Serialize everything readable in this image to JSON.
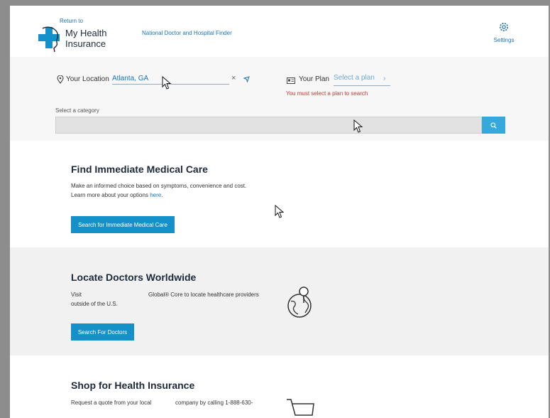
{
  "header": {
    "return_to": "Return to",
    "logo_line1": "My Health",
    "logo_line2": "Insurance",
    "finder_link": "National Doctor and Hospital Finder",
    "settings_label": "Settings"
  },
  "search": {
    "location_label": "Your Location",
    "location_value": "Atlanta, GA",
    "clear_symbol": "×",
    "plan_label": "Your Plan",
    "plan_select": "Select a plan",
    "plan_chevron": "›",
    "plan_error": "You must select a plan to search",
    "category_label": "Select a category"
  },
  "sections": {
    "immediate": {
      "title": "Find Immediate Medical Care",
      "text1": "Make an informed choice based on symptoms, convenience and cost.",
      "text2_prefix": "Learn more about your options ",
      "text2_link": "here",
      "text2_suffix": ".",
      "button": "Search for Immediate Medical Care"
    },
    "worldwide": {
      "title": "Locate Doctors Worldwide",
      "text_left1": "Visit",
      "text_left2": "outside of the U.S.",
      "text_right": "Global® Core to locate healthcare providers",
      "button": "Search For Doctors"
    },
    "shop": {
      "title": "Shop for Health Insurance",
      "text_a": "Request a quote from your local",
      "text_b": "company by calling 1-888-630-"
    }
  },
  "colors": {
    "brand_blue": "#1591c9",
    "link_blue": "#1a73b8",
    "error_red": "#d13434"
  }
}
